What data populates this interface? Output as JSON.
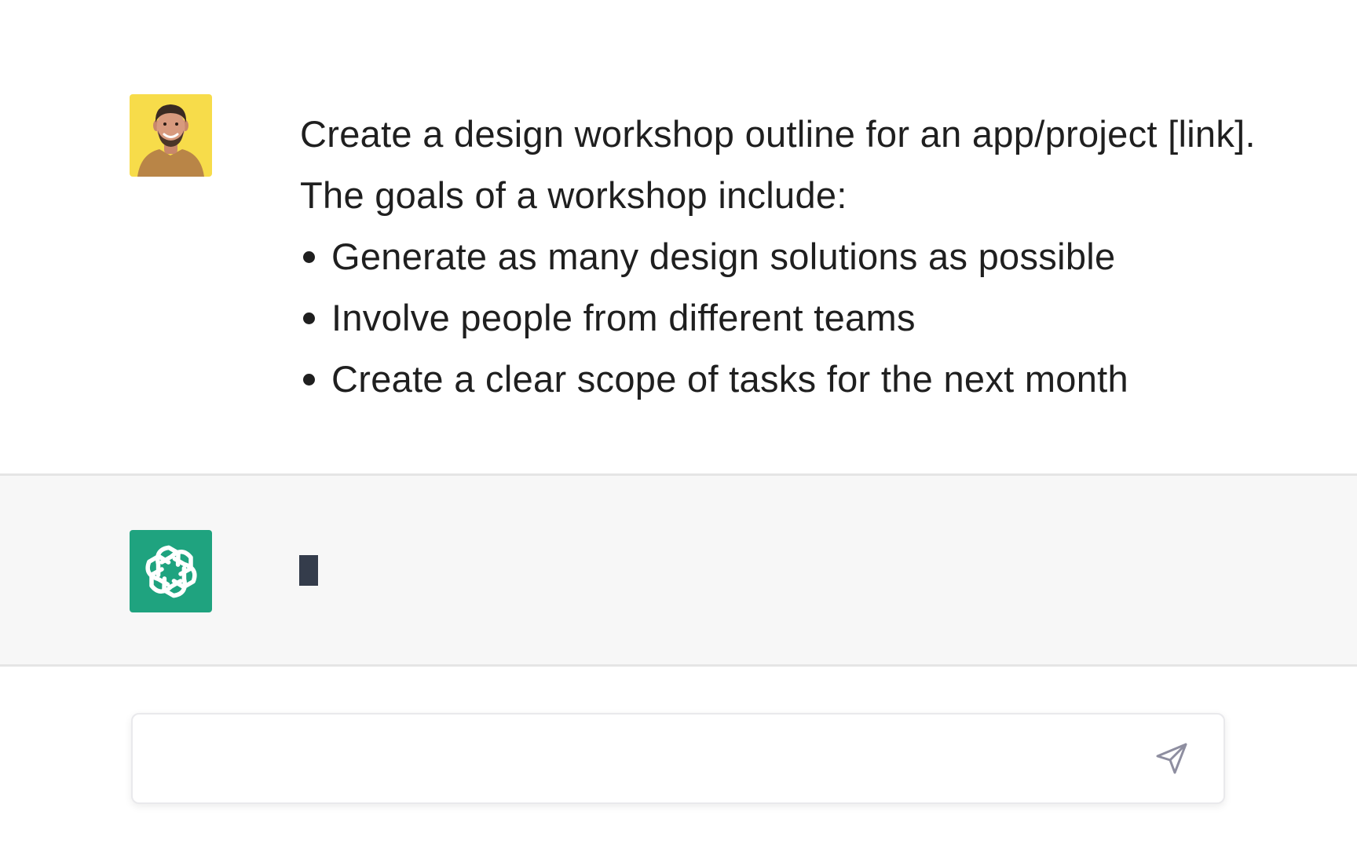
{
  "conversation": {
    "user_message": {
      "intro": "Create a design workshop outline for an app/project [link]. The goals of a workshop include:",
      "goals": [
        "Generate as many design solutions as possible",
        "Involve people from different teams",
        "Create a clear scope of tasks for the next month"
      ]
    }
  },
  "composer": {
    "value": "",
    "placeholder": ""
  },
  "icons": {
    "user_avatar": "user-avatar-photo",
    "assistant_avatar": "openai-logo-icon",
    "send": "send-paper-plane-icon"
  },
  "colors": {
    "user_avatar_bg": "#f7dc4a",
    "assistant_avatar_bg": "#1fa37f",
    "assistant_row_bg": "#f7f7f7",
    "cursor": "#343c4b",
    "send_icon": "#8e8ea0"
  }
}
